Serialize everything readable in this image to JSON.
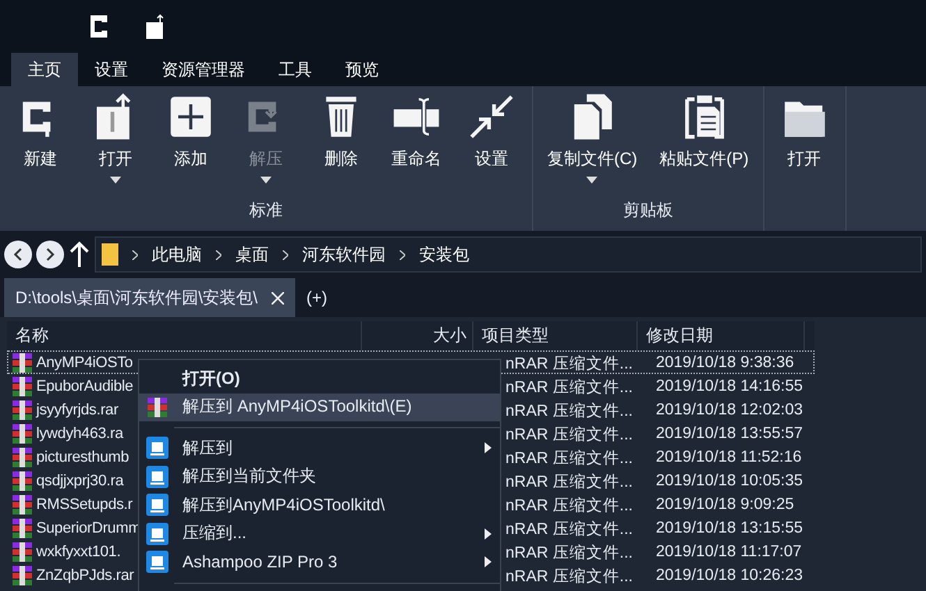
{
  "menu_tabs": [
    {
      "label": "主页",
      "selected": true
    },
    {
      "label": "设置",
      "selected": false
    },
    {
      "label": "资源管理器",
      "selected": false
    },
    {
      "label": "工具",
      "selected": false
    },
    {
      "label": "预览",
      "selected": false
    }
  ],
  "ribbon": {
    "groups": [
      {
        "label": "标准",
        "buttons": [
          {
            "kind": "clamp",
            "label": "新建",
            "dropdown": false,
            "disabled": false
          },
          {
            "kind": "open-archive",
            "label": "打开",
            "dropdown": true,
            "disabled": false
          },
          {
            "kind": "add",
            "label": "添加",
            "dropdown": false,
            "disabled": false
          },
          {
            "kind": "extract",
            "label": "解压",
            "dropdown": true,
            "disabled": true
          },
          {
            "kind": "delete",
            "label": "删除",
            "dropdown": false,
            "disabled": false
          },
          {
            "kind": "rename",
            "label": "重命名",
            "dropdown": false,
            "disabled": false
          },
          {
            "kind": "settings",
            "label": "设置",
            "dropdown": false,
            "disabled": false
          }
        ]
      },
      {
        "label": "剪贴板",
        "buttons": [
          {
            "kind": "copy",
            "label": "复制文件(C)",
            "dropdown": true,
            "disabled": false
          },
          {
            "kind": "paste",
            "label": "粘贴文件(P)",
            "dropdown": false,
            "disabled": false
          }
        ]
      },
      {
        "buttons": [
          {
            "kind": "folder",
            "label": "打开",
            "dropdown": false,
            "disabled": false
          }
        ]
      }
    ]
  },
  "breadcrumb": [
    "此电脑",
    "桌面",
    "河东软件园",
    "安装包"
  ],
  "doc_tabs": [
    {
      "label": "D:\\tools\\桌面\\河东软件园\\安装包\\",
      "selected": true
    },
    {
      "label": "(+)",
      "selected": false
    }
  ],
  "table": {
    "columns": [
      "名称",
      "大小",
      "项目类型",
      "修改日期"
    ],
    "rows": [
      {
        "name": "AnyMP4iOSTo",
        "type": "nRAR 压缩文件...",
        "date": "2019/10/18 9:38:36",
        "focused": true
      },
      {
        "name": "EpuborAudible",
        "type": "nRAR 压缩文件...",
        "date": "2019/10/18 14:16:55",
        "focused": false
      },
      {
        "name": "jsyyfyrjds.rar",
        "type": "nRAR 压缩文件...",
        "date": "2019/10/18 12:02:03",
        "focused": false
      },
      {
        "name": "lywdyh463.ra",
        "type": "nRAR 压缩文件...",
        "date": "2019/10/18 13:55:57",
        "focused": false
      },
      {
        "name": "picturesthumb",
        "type": "nRAR 压缩文件...",
        "date": "2019/10/18 11:52:16",
        "focused": false
      },
      {
        "name": "qsdjjxprj30.ra",
        "type": "nRAR 压缩文件...",
        "date": "2019/10/18 10:05:35",
        "focused": false
      },
      {
        "name": "RMSSetupds.r",
        "type": "nRAR 压缩文件...",
        "date": "2019/10/18 9:09:25",
        "focused": false
      },
      {
        "name": "SuperiorDrumm",
        "type": "nRAR 压缩文件...",
        "date": "2019/10/18 13:15:55",
        "focused": false
      },
      {
        "name": "wxkfyxxt101.",
        "type": "nRAR 压缩文件...",
        "date": "2019/10/18 11:17:07",
        "focused": false
      },
      {
        "name": "ZnZqbPJds.rar",
        "type": "nRAR 压缩文件...",
        "date": "2019/10/18 10:26:23",
        "focused": false
      }
    ]
  },
  "context_menu": {
    "items": [
      {
        "kind": "plain",
        "label": "打开(O)",
        "submenu": false,
        "selected": false,
        "bold": true
      },
      {
        "kind": "archive",
        "label": "解压到 AnyMP4iOSToolkitd\\(E)",
        "submenu": false,
        "selected": true,
        "bold": false
      },
      {
        "kind": "separator"
      },
      {
        "kind": "app",
        "label": "解压到",
        "submenu": true,
        "selected": false,
        "bold": false
      },
      {
        "kind": "app",
        "label": "解压到当前文件夹",
        "submenu": false,
        "selected": false,
        "bold": false
      },
      {
        "kind": "app",
        "label": "解压到AnyMP4iOSToolkitd\\",
        "submenu": false,
        "selected": false,
        "bold": false
      },
      {
        "kind": "app",
        "label": "压缩到...",
        "submenu": true,
        "selected": false,
        "bold": false
      },
      {
        "kind": "app",
        "label": "Ashampoo ZIP Pro 3",
        "submenu": true,
        "selected": false,
        "bold": false
      },
      {
        "kind": "separator"
      }
    ]
  }
}
